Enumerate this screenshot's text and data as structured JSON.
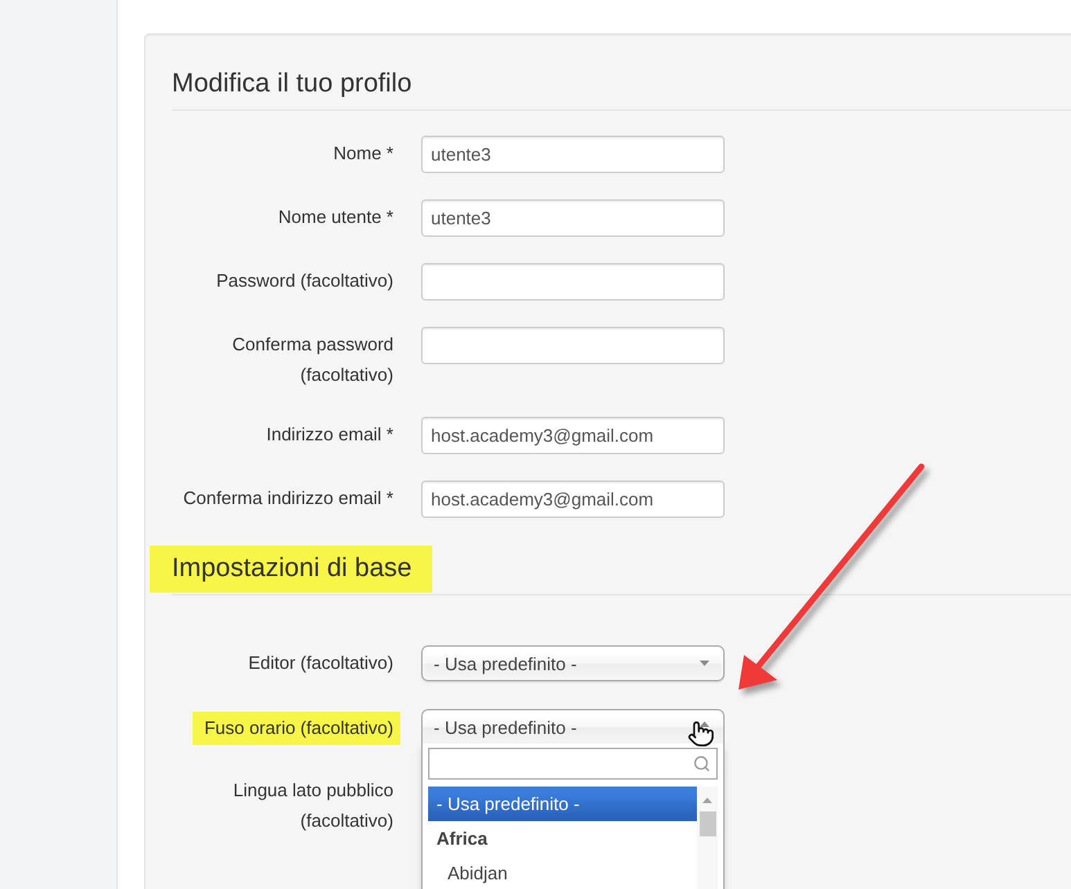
{
  "sections": [
    {
      "title": "Modifica il tuo profilo",
      "highlighted": false,
      "fields": [
        {
          "kind": "text",
          "label": "Nome *",
          "value": "utente3",
          "highlighted": false
        },
        {
          "kind": "text",
          "label": "Nome utente *",
          "value": "utente3",
          "highlighted": false
        },
        {
          "kind": "password",
          "label": "Password (facoltativo)",
          "highlighted": false
        },
        {
          "kind": "password",
          "label": "Conferma password (facoltativo)",
          "highlighted": false
        },
        {
          "kind": "text",
          "label": "Indirizzo email *",
          "value": "host.academy3@gmail.com",
          "highlighted": false
        },
        {
          "kind": "text",
          "label": "Conferma indirizzo email *",
          "value": "host.academy3@gmail.com",
          "highlighted": false
        }
      ]
    },
    {
      "title": "Impostazioni di base",
      "highlighted": true,
      "fields": [
        {
          "kind": "select",
          "label": "Editor (facoltativo)",
          "value": "- Usa predefinito -",
          "expanded": false,
          "highlighted": false
        },
        {
          "kind": "select",
          "label": "Fuso orario (facoltativo)",
          "value": "- Usa predefinito -",
          "expanded": true,
          "highlighted": true,
          "options": [
            {
              "kind": "option",
              "label": "- Usa predefinito -",
              "selected": true
            },
            {
              "kind": "group",
              "label": "Africa",
              "children": [
                {
                  "kind": "option",
                  "label": "Abidjan",
                  "selected": false
                }
              ]
            }
          ]
        },
        {
          "kind": "covered",
          "label": "Lingua lato pubblico (facoltativo)",
          "highlighted": false
        }
      ]
    }
  ]
}
